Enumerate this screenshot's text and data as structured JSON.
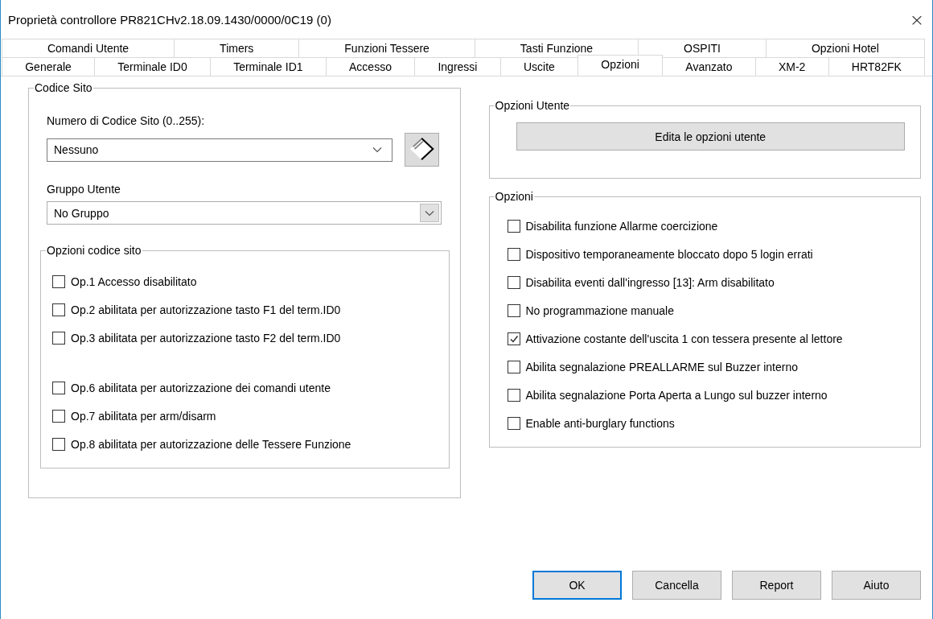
{
  "window": {
    "title": "Proprietà controllore PR821CHv2.18.09.1430/0000/0C19 (0)",
    "close": "×"
  },
  "tab_rows": [
    {
      "tabs": [
        {
          "label": "Comandi Utente",
          "selected": false
        },
        {
          "label": "Timers",
          "selected": false
        },
        {
          "label": "Funzioni Tessere",
          "selected": false
        },
        {
          "label": "Tasti Funzione",
          "selected": false
        },
        {
          "label": "OSPITI",
          "selected": false
        },
        {
          "label": "Opzioni Hotel",
          "selected": false
        }
      ]
    },
    {
      "tabs": [
        {
          "label": "Generale",
          "selected": false
        },
        {
          "label": "Terminale ID0",
          "selected": false
        },
        {
          "label": "Terminale ID1",
          "selected": false
        },
        {
          "label": "Accesso",
          "selected": false
        },
        {
          "label": "Ingressi",
          "selected": false
        },
        {
          "label": "Uscite",
          "selected": false
        },
        {
          "label": "Opzioni",
          "selected": true
        },
        {
          "label": "Avanzato",
          "selected": false
        },
        {
          "label": "XM-2",
          "selected": false
        },
        {
          "label": "HRT82FK",
          "selected": false
        }
      ]
    }
  ],
  "codice_sito": {
    "title": "Codice Sito",
    "numero": {
      "label": "Numero di Codice Sito (0..255):",
      "value": "Nessuno"
    },
    "gruppo": {
      "label": "Gruppo Utente",
      "value": "No Gruppo"
    },
    "opzioni_codice_sito": {
      "title": "Opzioni codice sito",
      "blocks": [
        {
          "items": [
            {
              "label": "Op.1 Accesso disabilitato",
              "checked": false
            },
            {
              "label": "Op.2 abilitata per autorizzazione tasto F1 del term.ID0",
              "checked": false
            },
            {
              "label": "Op.3 abilitata per autorizzazione tasto F2 del term.ID0",
              "checked": false
            }
          ]
        },
        {
          "items": [
            {
              "label": "Op.6 abilitata per autorizzazione dei comandi utente",
              "checked": false
            },
            {
              "label": "Op.7 abilitata per arm/disarm",
              "checked": false
            },
            {
              "label": "Op.8 abilitata per autorizzazione delle Tessere Funzione",
              "checked": false
            }
          ]
        }
      ]
    }
  },
  "opzioni_utente": {
    "title": "Opzioni Utente",
    "button": "Edita le opzioni utente"
  },
  "opzioni": {
    "title": "Opzioni",
    "items": [
      {
        "label": "Disabilita funzione Allarme coercizione",
        "checked": false
      },
      {
        "label": "Dispositivo temporaneamente bloccato dopo 5 login errati",
        "checked": false
      },
      {
        "label": "Disabilita eventi dall'ingresso [13]: Arm disabilitato",
        "checked": false
      },
      {
        "label": "No programmazione manuale",
        "checked": false
      },
      {
        "label": "Attivazione costante dell'uscita 1 con tessera presente al lettore",
        "checked": true
      },
      {
        "label": "Abilita segnalazione PREALLARME sul Buzzer interno",
        "checked": false
      },
      {
        "label": "Abilita segnalazione Porta Aperta a Lungo sul buzzer interno",
        "checked": false
      },
      {
        "label": "Enable anti-burglary functions",
        "checked": false
      }
    ]
  },
  "buttons": [
    {
      "label": "OK",
      "default": true
    },
    {
      "label": "Cancella",
      "default": false
    },
    {
      "label": "Report",
      "default": false
    },
    {
      "label": "Aiuto",
      "default": false
    }
  ]
}
